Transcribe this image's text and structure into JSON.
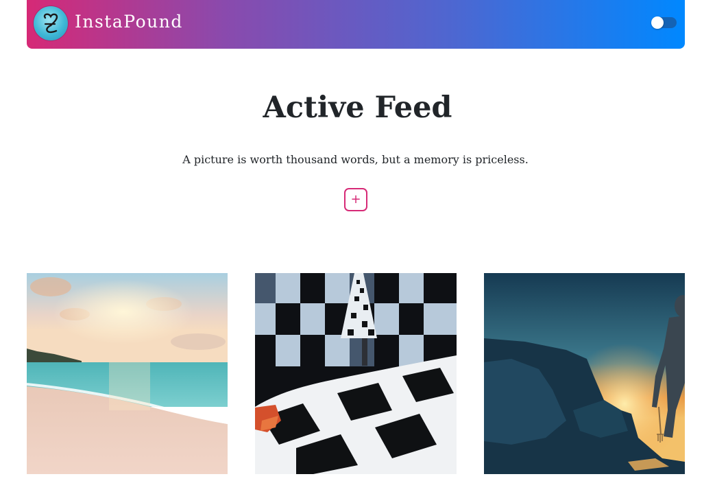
{
  "navbar": {
    "brand_name": "InstaPound",
    "logo_icon": "heart-key-logo-icon",
    "theme_toggle_state": "off"
  },
  "main": {
    "title": "Active Feed",
    "tagline": "A picture is worth thousand words, but a memory is priceless.",
    "add_label": "+"
  },
  "posts": [
    {
      "subject": "beach-sunset-photo"
    },
    {
      "subject": "checkered-room-photo"
    },
    {
      "subject": "armored-warrior-sunset-photo"
    }
  ],
  "colors": {
    "gradient_start": "#d62976",
    "gradient_end": "#0088ff",
    "accent": "#d62976",
    "text": "#212529"
  }
}
